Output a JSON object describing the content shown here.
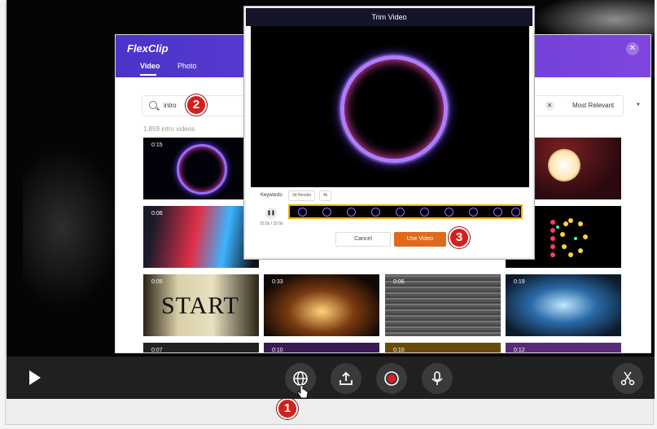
{
  "flexclip": {
    "logo": "FlexClip",
    "tabs": [
      "Video",
      "Photo"
    ],
    "search_value": "intro",
    "sort_label": "Most Relevant",
    "results_count": "1,859",
    "results_term": "intro",
    "results_suffix": "videos",
    "thumbs": [
      {
        "duration": "0:15"
      },
      {
        "duration": "0:06"
      },
      {
        "duration": "0:05"
      },
      {
        "duration": "0:33"
      },
      {
        "duration": "0:06"
      },
      {
        "duration": "0:19"
      },
      {
        "duration": "0:07"
      },
      {
        "duration": "0:10"
      },
      {
        "duration": "0:10"
      },
      {
        "duration": "0:12"
      }
    ],
    "start_thumb_text": "START"
  },
  "trim": {
    "title": "Trim Video",
    "keywords_label": "Keywords:",
    "keywords": [
      "3d Render",
      "4k"
    ],
    "time": "15.5s / 15.0s",
    "cancel_label": "Cancel",
    "use_label": "Use Video",
    "pause_glyph": "❚❚"
  },
  "badges": [
    "1",
    "2",
    "3"
  ],
  "toolbar": {
    "icons": [
      "play-icon",
      "globe-icon",
      "upload-icon",
      "record-icon",
      "microphone-icon",
      "scissors-icon"
    ]
  },
  "colors": {
    "flexclip_header_start": "#4a34c9",
    "flexclip_header_end": "#7f46de",
    "use_video_button": "#e06a1c",
    "badge": "#d41f1f",
    "trim_strip_border": "#f0b400"
  }
}
